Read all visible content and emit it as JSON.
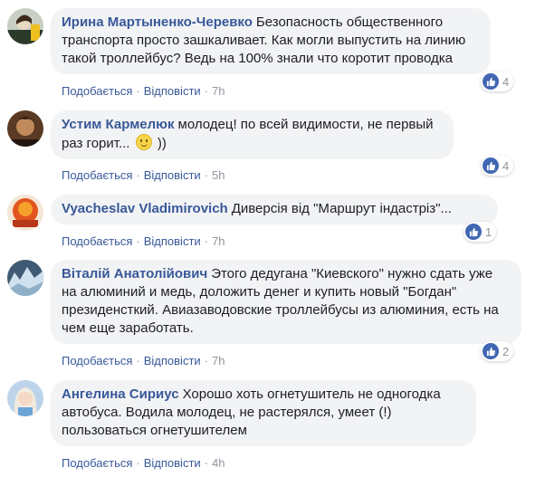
{
  "comments": [
    {
      "author": "Ирина Мартыненко-Черевко",
      "text": "Безопасность общественного транспорта просто зашкаливает. Как могли выпустить на линию такой троллейбус? Ведь на 100% знали что коротит проводка",
      "like_label": "Подобається",
      "reply_label": "Відповісти",
      "time": "7h",
      "reactions": "4"
    },
    {
      "author": "Устим Кармелюк",
      "text_before_emoji": "молодец! по всей видимости, не первый раз горит...",
      "text_after_emoji": "))",
      "like_label": "Подобається",
      "reply_label": "Відповісти",
      "time": "5h",
      "reactions": "4"
    },
    {
      "author": "Vyacheslav Vladimirovich",
      "text": "Диверсія від \"Маршрут індастріз\"...",
      "like_label": "Подобається",
      "reply_label": "Відповісти",
      "time": "7h",
      "reactions": "1"
    },
    {
      "author": "Віталій Анатолійович",
      "text": "Этого дедугана \"Киевского\" нужно сдать уже на алюминий и медь, доложить денег и купить новый \"Богдан\" президенсткий. Авиазаводовские троллейбусы из алюминия, есть на чем еще заработать.",
      "like_label": "Подобається",
      "reply_label": "Відповісти",
      "time": "7h",
      "reactions": "2"
    },
    {
      "author": "Ангелина Сириус",
      "text": "Хорошо хоть огнетушитель не одногодка автобуса. Водила молодец, не растерялся, умеет (!) пользоваться огнетушителем",
      "like_label": "Подобається",
      "reply_label": "Відповісти",
      "time": "4h"
    }
  ],
  "separator": "·",
  "colors": {
    "author": "#385898",
    "bubble": "#f2f3f5",
    "meta": "#90949c",
    "like": "#4267b2"
  }
}
